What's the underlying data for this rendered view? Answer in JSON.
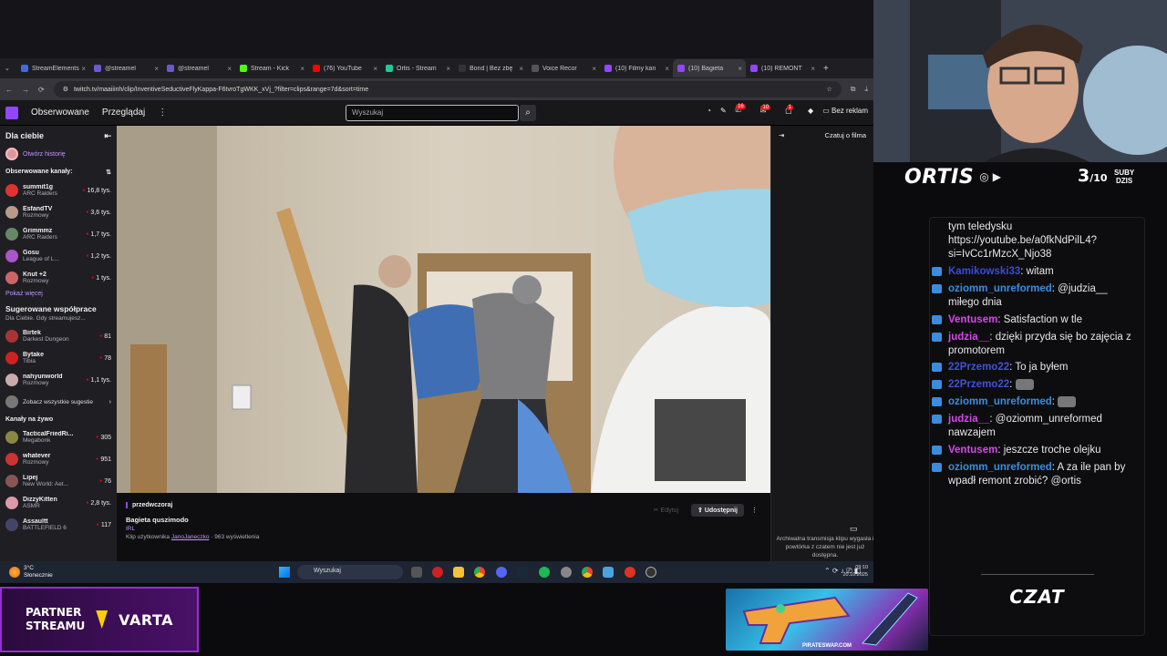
{
  "browser": {
    "tabs": [
      {
        "label": "StreamElements",
        "color": "#4169e1"
      },
      {
        "label": "@streamel",
        "color": "#6a5acd"
      },
      {
        "label": "@streamel",
        "color": "#6a5acd"
      },
      {
        "label": "Stream - Kick",
        "color": "#53fc18"
      },
      {
        "label": "(76) YouTube",
        "color": "#ff0000"
      },
      {
        "label": "Ortis - Stream",
        "color": "#20c997"
      },
      {
        "label": "Bond | Bez zbę",
        "color": "#333"
      },
      {
        "label": "Voice Recor",
        "color": "#555"
      },
      {
        "label": "(10) Filmy kan",
        "color": "#9146ff"
      },
      {
        "label": "(10) Bagieta",
        "color": "#9146ff"
      },
      {
        "label": "(10) REMONT",
        "color": "#9146ff"
      }
    ],
    "url": "twitch.tv/maaiiinh/clip/InventiveSeductiveFlyKappa-F6tvroTgWKK_xVj_?filter=clips&range=7d&sort=time"
  },
  "twitch_header": {
    "following": "Obserwowane",
    "browse": "Przeglądaj",
    "search_placeholder": "Wyszukaj",
    "badge1": "16",
    "badge2": "10",
    "badge3": "1",
    "ads": "Bez reklam"
  },
  "sidebar": {
    "for_you": "Dla ciebie",
    "open_history": "Otwórz historię",
    "followed": "Obserwowane kanały:",
    "followed_channels": [
      {
        "name": "summit1g",
        "game": "ARC Raiders",
        "viewers": "16,8 tys.",
        "color": "#d33"
      },
      {
        "name": "EsfandTV",
        "game": "Rozmowy",
        "viewers": "3,6 tys.",
        "color": "#b98"
      },
      {
        "name": "Grimmmz",
        "game": "ARC Raiders",
        "viewers": "1,7 tys.",
        "color": "#686"
      },
      {
        "name": "Gosu",
        "game": "League of L...",
        "viewers": "1,2 tys.",
        "color": "#a5c"
      },
      {
        "name": "Knut +2",
        "game": "Rozmowy",
        "viewers": "1 tys.",
        "color": "#c66"
      }
    ],
    "show_more": "Pokaż więcej",
    "suggested_title": "Sugerowane współprace",
    "suggested_desc": "Dla Ciebie. Gdy streamujesz...",
    "suggested_channels": [
      {
        "name": "Birtek",
        "game": "Darkest Dungeon",
        "viewers": "81",
        "color": "#a33"
      },
      {
        "name": "Bytake",
        "game": "Tibia",
        "viewers": "78",
        "color": "#c22"
      },
      {
        "name": "nahyunworld",
        "game": "Rozmowy",
        "viewers": "1,1 tys.",
        "color": "#caa"
      }
    ],
    "see_all": "Zobacz wszystkie sugestie",
    "live_title": "Kanały na żywo",
    "live_channels": [
      {
        "name": "TacticalFriedRi...",
        "game": "Megabonk",
        "viewers": "305",
        "color": "#884"
      },
      {
        "name": "whatever",
        "game": "Rozmowy",
        "viewers": "951",
        "color": "#c33"
      },
      {
        "name": "Lipej",
        "game": "New World: Aet...",
        "viewers": "76",
        "color": "#855"
      },
      {
        "name": "DizzyKitten",
        "game": "ASMR",
        "viewers": "2,8 tys.",
        "color": "#d9a"
      },
      {
        "name": "Assaultt",
        "game": "BATTLEFIELD 6",
        "viewers": "117",
        "color": "#446"
      }
    ]
  },
  "clip": {
    "date": "przedwczoraj",
    "title": "Bagieta quszimodo",
    "category": "IRL",
    "by_prefix": "Klip użytkownika",
    "author": "JanoJaneczko",
    "views": "· 963 wyświetlenia",
    "edit": "Edytuj",
    "share": "Udostępnij"
  },
  "chat_panel": {
    "title": "Czatuj o filma",
    "archive_note": "Archiwalna transmisja klipu wygasła i powtórka z czatem nie jest już dostępna."
  },
  "taskbar": {
    "temp": "3°C",
    "weather": "Słonecznie",
    "search": "Wyszukaj",
    "time": "09:10",
    "date": "20.10.2025"
  },
  "overlay": {
    "streamer": "ORTIS",
    "subs_current": "3",
    "subs_total": "/10",
    "subs_label_1": "SUBY",
    "subs_label_2": "DZIS",
    "czat": "CZAT",
    "partner_1": "PARTNER",
    "partner_2": "STREAMU",
    "sponsor_brand": "VARTA",
    "sponsor_site": "PIRATESWAP.COM"
  },
  "stream_chat": [
    {
      "user": "",
      "text": "tym teledysku https://youtube.be/a0fkNdPilL4?si=IvCc1rMzcX_Njo38",
      "color": "#ffffff"
    },
    {
      "user": "Kamikowski33",
      "text": "witam",
      "color": "#3b4ad8"
    },
    {
      "user": "oziomm_unreformed",
      "text": "@judzia__ miłego dnia",
      "color": "#3a8dde"
    },
    {
      "user": "Ventusem",
      "text": "Satisfaction w tle",
      "color": "#d946ef"
    },
    {
      "user": "judzia__",
      "text": "dzięki przyda się bo zajęcia z promotorem",
      "color": "#d946ef"
    },
    {
      "user": "22Przemo22",
      "text": "To ja byłem",
      "color": "#4052d6"
    },
    {
      "user": "22Przemo22",
      "text": "",
      "color": "#4052d6"
    },
    {
      "user": "oziomm_unreformed",
      "text": "",
      "color": "#3a8dde"
    },
    {
      "user": "judzia__",
      "text": "@oziomm_unreformed nawzajem",
      "color": "#d946ef"
    },
    {
      "user": "Ventusem",
      "text": "jeszcze troche olejku",
      "color": "#d946ef"
    },
    {
      "user": "oziomm_unreformed",
      "text": "A za ile pan by wpadł remont zrobić? @ortis",
      "color": "#3a8dde"
    }
  ]
}
